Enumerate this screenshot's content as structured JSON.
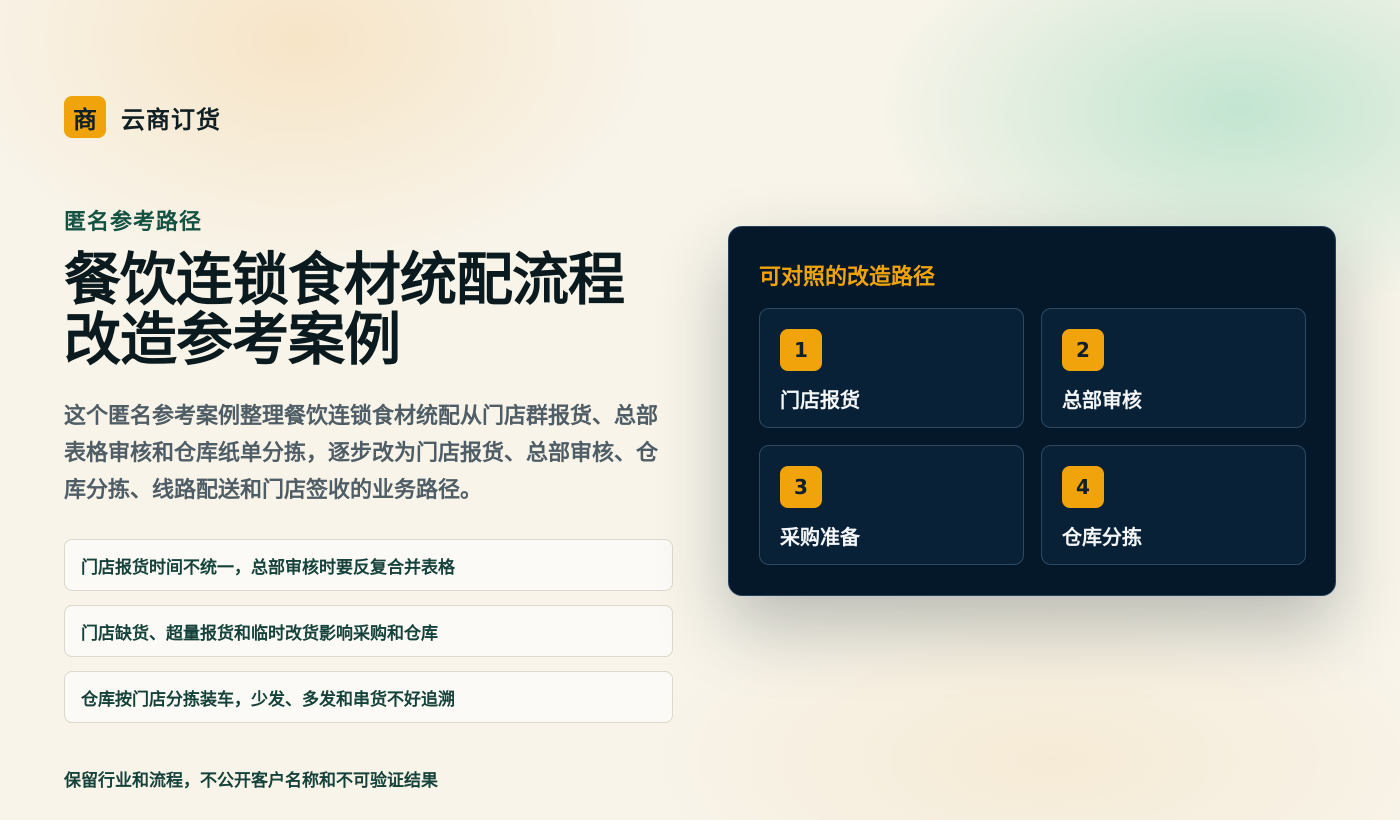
{
  "brand": {
    "logo_char": "商",
    "name": "云商订货"
  },
  "hero": {
    "eyebrow": "匿名参考路径",
    "title_line1": "餐饮连锁食材统配流程",
    "title_line2": "改造参考案例",
    "description": "这个匿名参考案例整理餐饮连锁食材统配从门店群报货、总部表格审核和仓库纸单分拣，逐步改为门店报货、总部审核、仓库分拣、线路配送和门店签收的业务路径。"
  },
  "pain_points": [
    {
      "text": "门店报货时间不统一，总部审核时要反复合并表格"
    },
    {
      "text": "门店缺货、超量报货和临时改货影响采购和仓库"
    },
    {
      "text": "仓库按门店分拣装车，少发、多发和串货不好追溯"
    }
  ],
  "footnote": "保留行业和流程，不公开客户名称和不可验证结果",
  "panel": {
    "title": "可对照的改造路径",
    "steps": [
      {
        "num": "1",
        "label": "门店报货"
      },
      {
        "num": "2",
        "label": "总部审核"
      },
      {
        "num": "3",
        "label": "采购准备"
      },
      {
        "num": "4",
        "label": "仓库分拣"
      }
    ]
  },
  "colors": {
    "accent": "#f0a30a",
    "panel_bg": "#04182a",
    "heading_green": "#135243"
  }
}
